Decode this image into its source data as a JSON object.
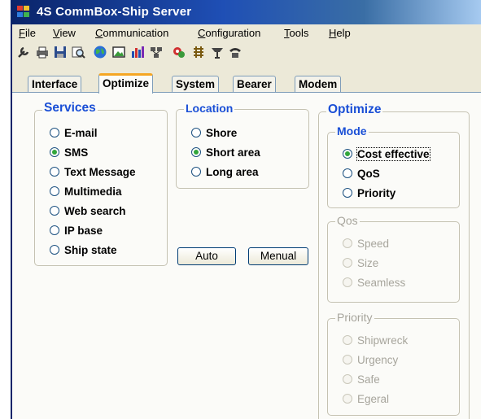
{
  "window": {
    "title": "4S CommBox-Ship Server"
  },
  "menu": [
    {
      "underline": "F",
      "rest": "ile"
    },
    {
      "underline": "V",
      "rest": "iew"
    },
    {
      "underline": "C",
      "rest": "ommunication"
    },
    {
      "underline": "C",
      "rest": "onfiguration"
    },
    {
      "underline": "T",
      "rest": "ools"
    },
    {
      "underline": "H",
      "rest": "elp"
    }
  ],
  "toolbar_icons": [
    "wrench-icon",
    "print-icon",
    "save-icon",
    "search-icon",
    "globe-icon",
    "image-icon",
    "chart-icon",
    "network-icon",
    "gears-icon",
    "grid-icon",
    "antenna-icon",
    "phone-icon"
  ],
  "tabs": [
    "Interface",
    "Optimize",
    "System",
    "Bearer",
    "Modem"
  ],
  "active_tab": "Optimize",
  "services": {
    "title": "Services",
    "options": [
      "E-mail",
      "SMS",
      "Text Message",
      "Multimedia",
      "Web search",
      "IP base",
      "Ship state"
    ],
    "selected": "SMS"
  },
  "location": {
    "title": "Location",
    "options": [
      "Shore",
      "Short area",
      "Long area"
    ],
    "selected": "Short area"
  },
  "buttons": {
    "auto": "Auto",
    "manual": "Menual"
  },
  "optimize": {
    "title": "Optimize",
    "mode": {
      "title": "Mode",
      "options": [
        "Cost effective",
        "QoS",
        "Priority"
      ],
      "selected": "Cost effective"
    },
    "qos": {
      "title": "Qos",
      "options": [
        "Speed",
        "Size",
        "Seamless"
      ]
    },
    "priority": {
      "title": "Priority",
      "options": [
        "Shipwreck",
        "Urgency",
        "Safe",
        "Egeral"
      ]
    }
  },
  "colors": {
    "title_gradient_start": "#0a246a",
    "legend_blue": "#1a4fd6",
    "radio_selected": "#31a63b",
    "active_tab_accent": "#f5a623"
  }
}
